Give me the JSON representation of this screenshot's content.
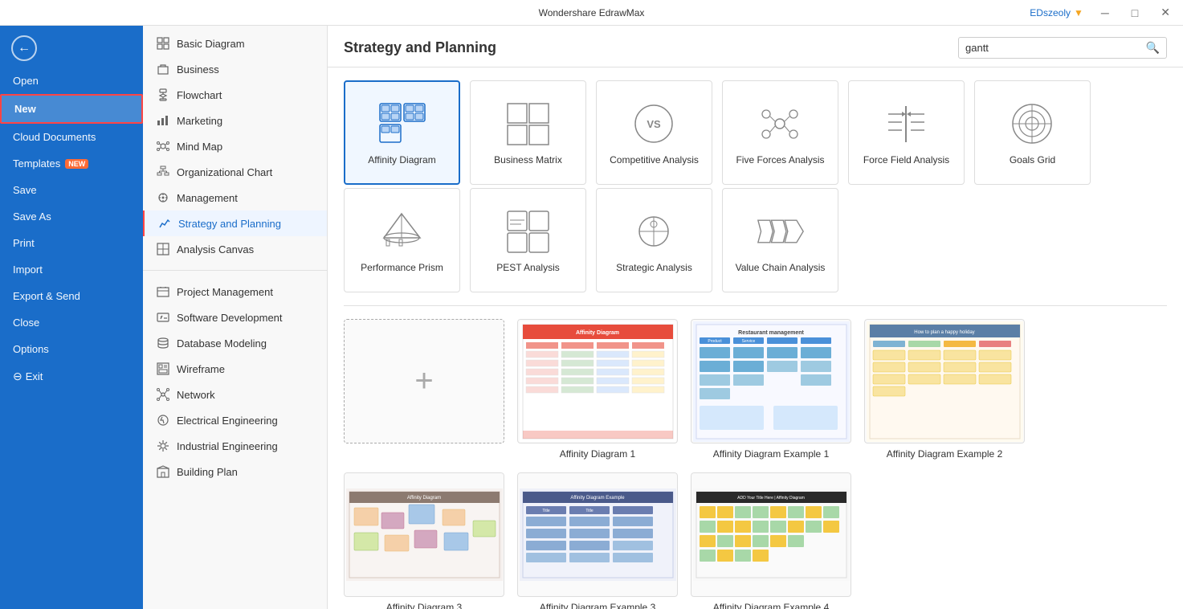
{
  "titleBar": {
    "appName": "Wondershare EdrawMax",
    "userName": "EDszeoly",
    "btnMinimize": "─",
    "btnMaximize": "□",
    "btnClose": "✕"
  },
  "sidebar": {
    "backLabel": "←",
    "items": [
      {
        "id": "open",
        "label": "Open",
        "active": false
      },
      {
        "id": "new",
        "label": "New",
        "active": true,
        "badge": null
      },
      {
        "id": "cloud",
        "label": "Cloud Documents",
        "active": false
      },
      {
        "id": "templates",
        "label": "Templates",
        "active": false,
        "badge": "NEW"
      },
      {
        "id": "save",
        "label": "Save",
        "active": false
      },
      {
        "id": "saveas",
        "label": "Save As",
        "active": false
      },
      {
        "id": "print",
        "label": "Print",
        "active": false
      },
      {
        "id": "import",
        "label": "Import",
        "active": false
      },
      {
        "id": "export",
        "label": "Export & Send",
        "active": false
      },
      {
        "id": "close",
        "label": "Close",
        "active": false
      },
      {
        "id": "options",
        "label": "Options",
        "active": false
      },
      {
        "id": "exit",
        "label": "Exit",
        "active": false
      }
    ]
  },
  "categoryNav": {
    "items": [
      {
        "id": "basic",
        "label": "Basic Diagram",
        "icon": "⬡",
        "active": false
      },
      {
        "id": "business",
        "label": "Business",
        "icon": "💼",
        "active": false
      },
      {
        "id": "flowchart",
        "label": "Flowchart",
        "icon": "⬡",
        "active": false
      },
      {
        "id": "marketing",
        "label": "Marketing",
        "icon": "📊",
        "active": false
      },
      {
        "id": "mindmap",
        "label": "Mind Map",
        "icon": "🧠",
        "active": false
      },
      {
        "id": "orgchart",
        "label": "Organizational Chart",
        "icon": "⬡",
        "active": false
      },
      {
        "id": "management",
        "label": "Management",
        "icon": "⚙",
        "active": false
      },
      {
        "id": "strategy",
        "label": "Strategy and Planning",
        "icon": "📈",
        "active": true
      },
      {
        "id": "analysis",
        "label": "Analysis Canvas",
        "icon": "⬡",
        "active": false
      },
      {
        "id": "project",
        "label": "Project Management",
        "icon": "⬡",
        "active": false
      },
      {
        "id": "software",
        "label": "Software Development",
        "icon": "⬡",
        "active": false
      },
      {
        "id": "database",
        "label": "Database Modeling",
        "icon": "⬡",
        "active": false
      },
      {
        "id": "wireframe",
        "label": "Wireframe",
        "icon": "⬡",
        "active": false
      },
      {
        "id": "network",
        "label": "Network",
        "icon": "⬡",
        "active": false
      },
      {
        "id": "electrical",
        "label": "Electrical Engineering",
        "icon": "⬡",
        "active": false
      },
      {
        "id": "industrial",
        "label": "Industrial Engineering",
        "icon": "⬡",
        "active": false
      },
      {
        "id": "building",
        "label": "Building Plan",
        "icon": "⬡",
        "active": false
      }
    ]
  },
  "mainSection": {
    "title": "Strategy and Planning",
    "searchPlaceholder": "gantt",
    "searchValue": "gantt"
  },
  "diagramTypes": [
    {
      "id": "affinity",
      "label": "Affinity Diagram",
      "selected": true
    },
    {
      "id": "business-matrix",
      "label": "Business Matrix",
      "selected": false
    },
    {
      "id": "competitive",
      "label": "Competitive Analysis",
      "selected": false
    },
    {
      "id": "five-forces",
      "label": "Five Forces Analysis",
      "selected": false
    },
    {
      "id": "force-field",
      "label": "Force Field Analysis",
      "selected": false
    },
    {
      "id": "goals-grid",
      "label": "Goals Grid",
      "selected": false
    },
    {
      "id": "performance-prism",
      "label": "Performance Prism",
      "selected": false
    },
    {
      "id": "pest",
      "label": "PEST Analysis",
      "selected": false
    },
    {
      "id": "strategic",
      "label": "Strategic Analysis",
      "selected": false
    },
    {
      "id": "value-chain",
      "label": "Value Chain Analysis",
      "selected": false
    }
  ],
  "templates": [
    {
      "id": "new-blank",
      "label": "",
      "type": "blank"
    },
    {
      "id": "affinity1",
      "label": "Affinity Diagram 1",
      "type": "thumb1"
    },
    {
      "id": "affinity-ex1",
      "label": "Affinity Diagram Example 1",
      "type": "thumb2"
    },
    {
      "id": "affinity-ex2",
      "label": "Affinity Diagram Example 2",
      "type": "thumb3"
    },
    {
      "id": "affinity3",
      "label": "Affinity Diagram 3",
      "type": "thumb4"
    },
    {
      "id": "affinity-ex3",
      "label": "Affinity Diagram Example 3",
      "type": "thumb5"
    },
    {
      "id": "affinity-ex4",
      "label": "Affinity Diagram Example 4",
      "type": "thumb6"
    }
  ]
}
